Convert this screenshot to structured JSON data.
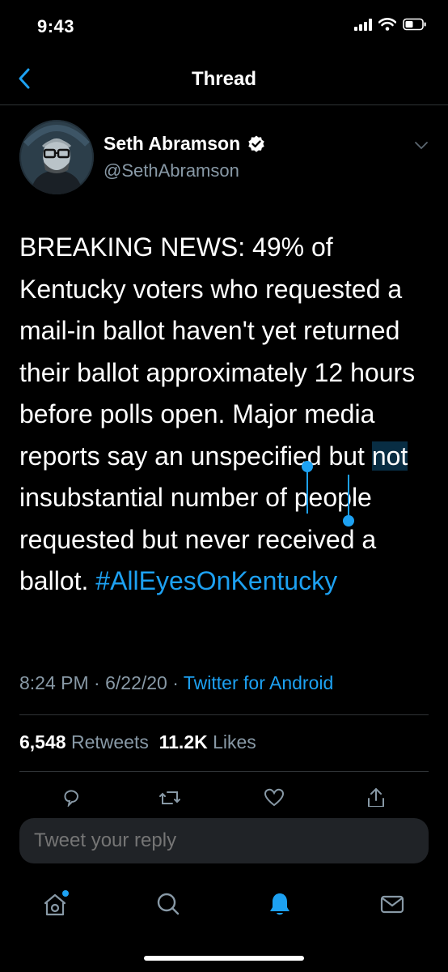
{
  "status_bar": {
    "time": "9:43"
  },
  "nav": {
    "title": "Thread"
  },
  "tweet": {
    "author_name": "Seth Abramson",
    "author_handle": "@SethAbramson",
    "text_part1": "BREAKING NEWS: 49% of Kentucky voters who requested a mail-in ballot haven't yet returned their ballot approximately 12 hours before polls open. Major media reports say an unspecified but ",
    "text_selected": "not",
    "text_part2": " insubstantial number of people requested but never received a ballot. ",
    "hashtag": "#AllEyesOnKentucky",
    "time": "8:24 PM",
    "date": "6/22/20",
    "separator": "·",
    "source": "Twitter for Android",
    "retweets_count": "6,548",
    "retweets_label": "Retweets",
    "likes_count": "11.2K",
    "likes_label": "Likes"
  },
  "reply": {
    "placeholder": "Tweet your reply"
  },
  "colors": {
    "accent": "#1da1f2",
    "muted": "#8899a6",
    "background": "#000000",
    "divider": "#2f3336"
  },
  "icons": [
    "chevron-left-icon",
    "verified-badge-icon",
    "chevron-down-icon",
    "reply-icon",
    "retweet-icon",
    "like-icon",
    "share-icon",
    "home-icon",
    "search-icon",
    "notifications-icon",
    "messages-icon"
  ]
}
